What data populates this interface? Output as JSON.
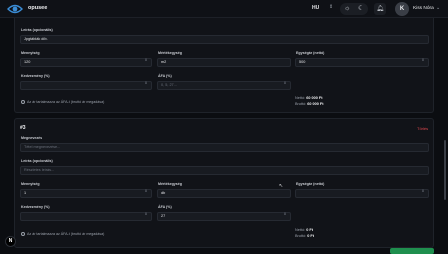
{
  "app": {
    "brand": "opusee"
  },
  "topbar": {
    "language": "HU",
    "user_initial": "K",
    "user_name": "Kiss Nóra"
  },
  "item1": {
    "description_label": "Leírás (opcionális)",
    "description_value": "Jpgtáblák díb.",
    "quantity_label": "Mennyiség",
    "quantity_value": "120",
    "unit_label": "Mértékegység",
    "unit_value": "m2",
    "unit_price_label": "Egységár (nettó)",
    "unit_price_value": "500",
    "discount_label": "Kedvezmény (%)",
    "discount_value": "",
    "vat_label": "ÁFA (%)",
    "vat_placeholder": "0, 5, 27...",
    "vat_included_label": "Az ár tartalmazza az ÁFA-t (bruttó ár megadása)",
    "net_label": "Nettó:",
    "net_value": "60 000 Ft",
    "gross_label": "Bruttó:",
    "gross_value": "60 000 Ft"
  },
  "item2": {
    "number": "#3",
    "delete_label": "Törlés",
    "name_label": "Megnevezés",
    "name_placeholder": "Tétel megnevezése...",
    "description_label": "Leírás (opcionális)",
    "description_placeholder": "Részletes leírás...",
    "quantity_label": "Mennyiség",
    "quantity_value": "1",
    "unit_label": "Mértékegység",
    "unit_value": "db",
    "unit_price_label": "Egységár (nettó)",
    "unit_price_value": "",
    "discount_label": "Kedvezmény (%)",
    "discount_value": "",
    "vat_label": "ÁFA (%)",
    "vat_value": "27",
    "vat_included_label": "Az ár tartalmazza az ÁFA-t (bruttó ár megadása)",
    "net_label": "Nettó:",
    "net_value": "0 Ft",
    "gross_label": "Bruttó:",
    "gross_value": "0 Ft"
  },
  "icons": {
    "logo": "eye-logo-icon",
    "sun": "sun-icon",
    "moon": "moon-icon",
    "bell": "bell-icon",
    "stepper": "stepper-icon",
    "chevron": "chevron-updown-icon"
  },
  "colors": {
    "accent_red": "#e0484f",
    "green": "#1f8f4e"
  },
  "badge": "N"
}
